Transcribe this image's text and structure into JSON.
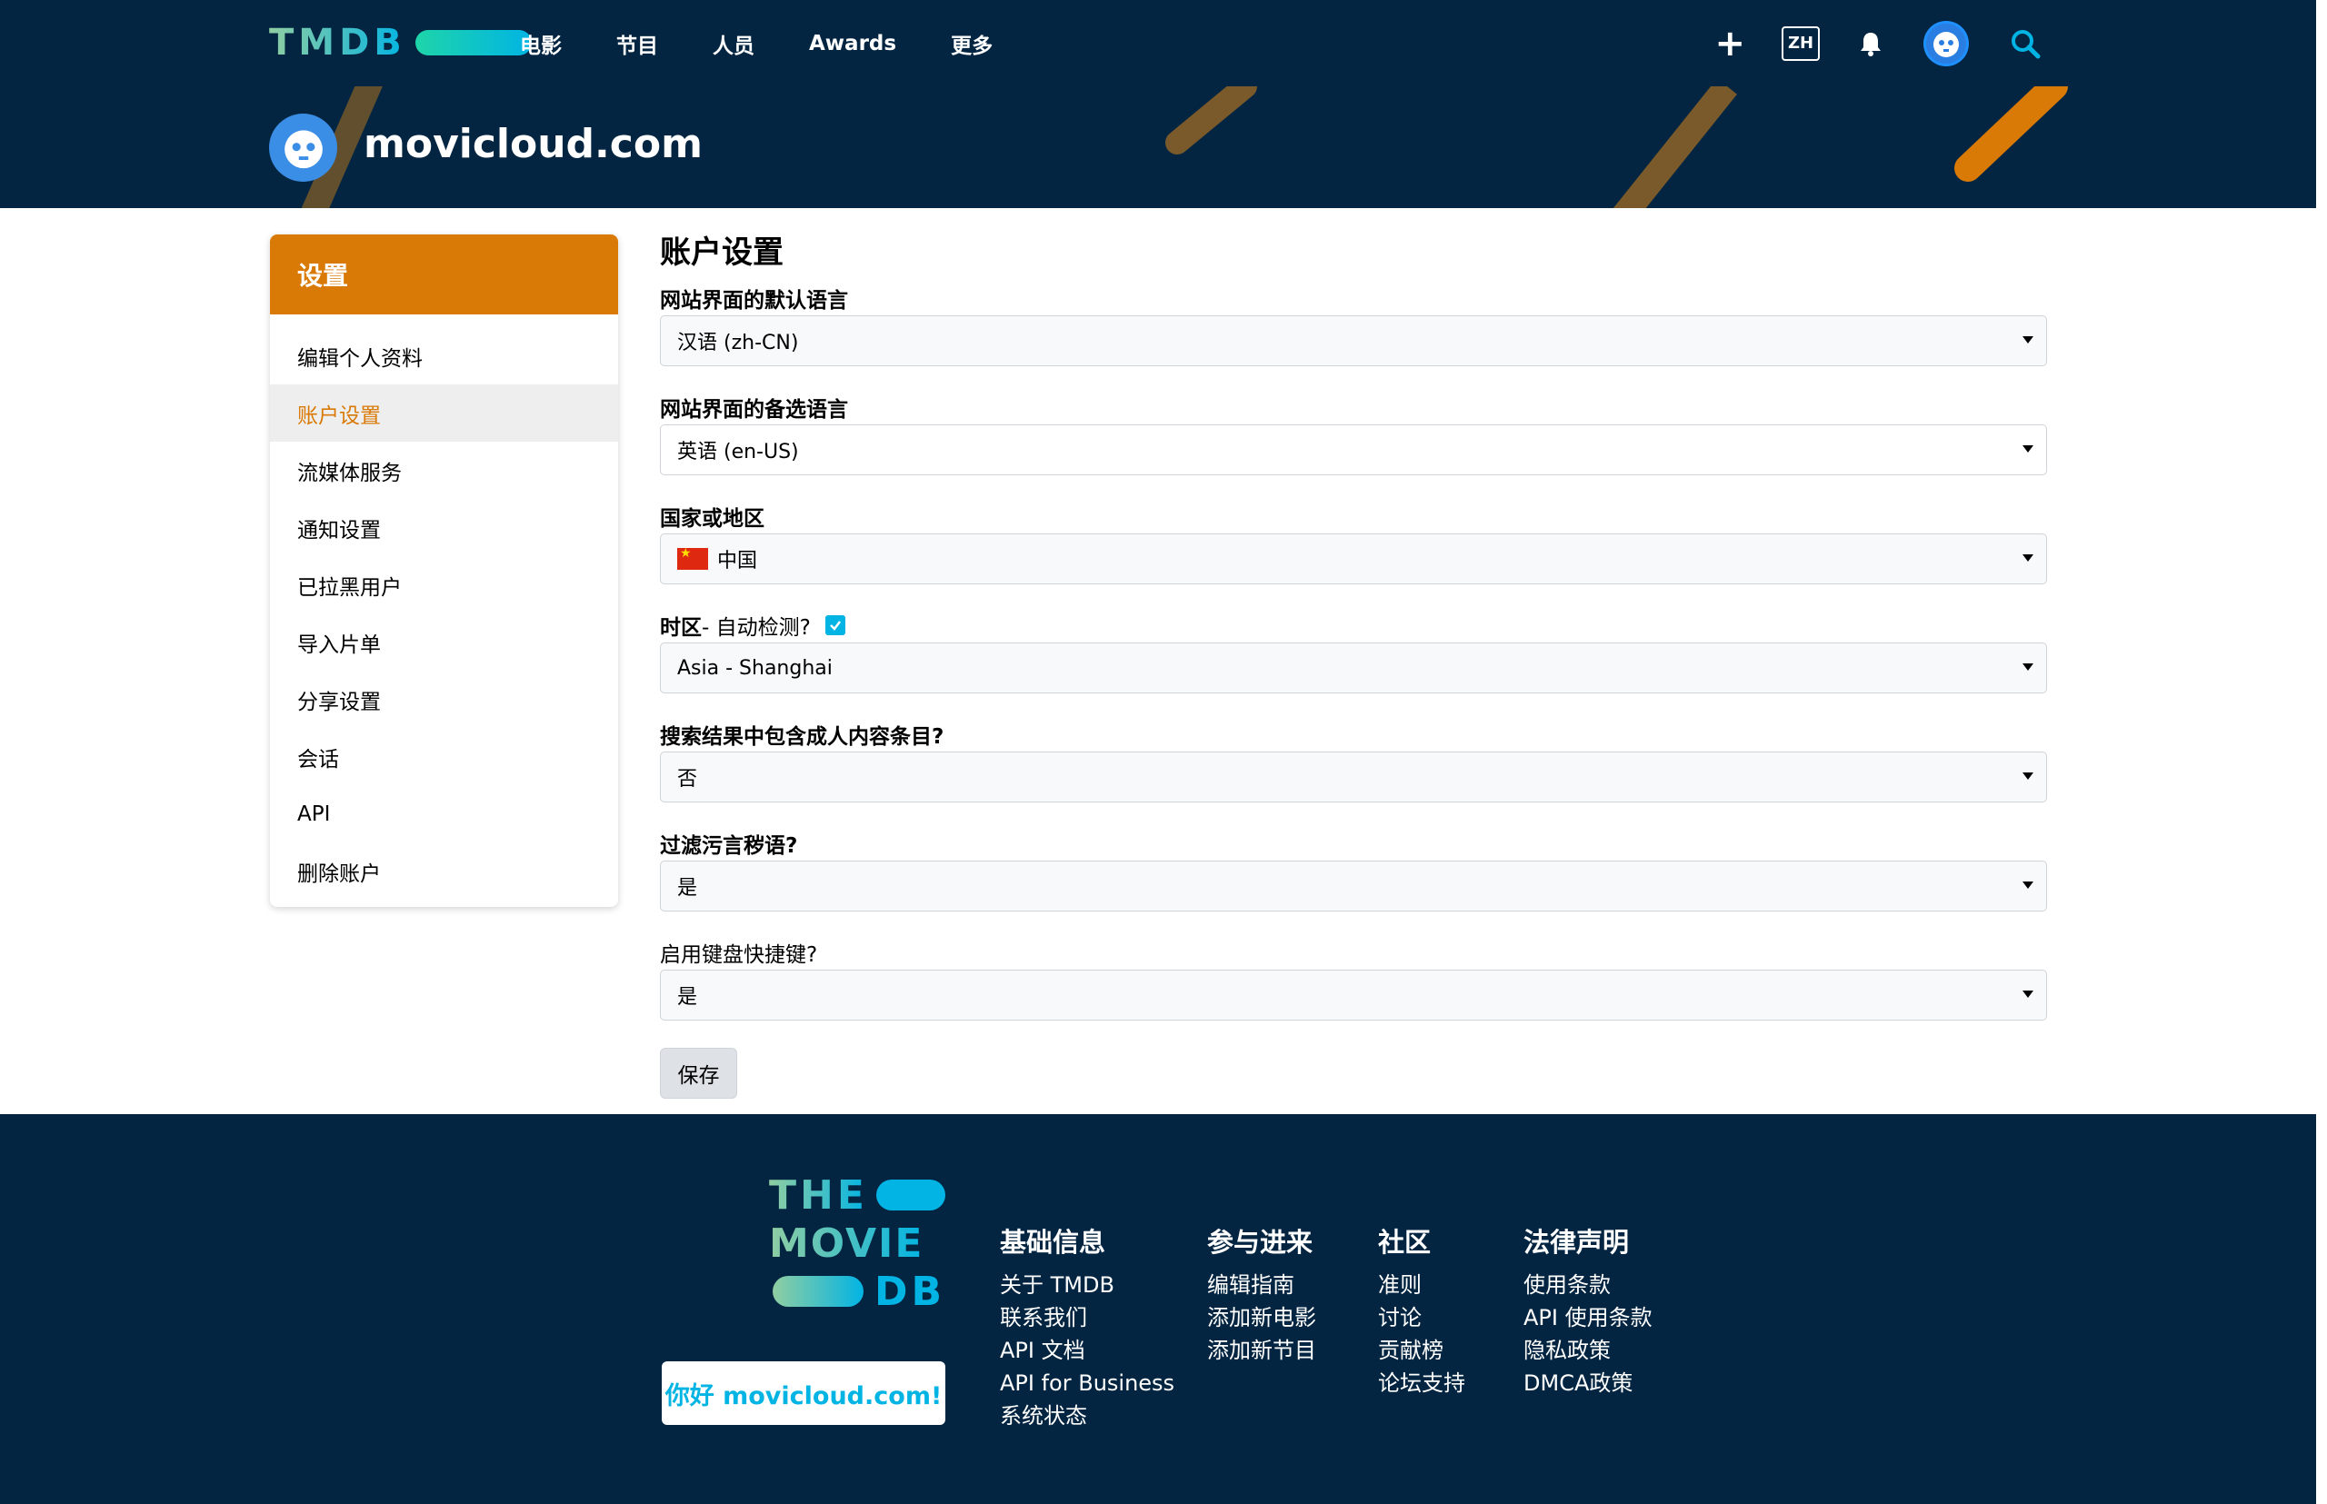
{
  "nav": {
    "logo": "TMDB",
    "links": [
      "电影",
      "节目",
      "人员",
      "Awards",
      "更多"
    ],
    "lang": "ZH",
    "plus": "+"
  },
  "profile": {
    "name": "movicloud.com"
  },
  "sidebar": {
    "header": "设置",
    "items": [
      {
        "label": "编辑个人资料"
      },
      {
        "label": "账户设置"
      },
      {
        "label": "流媒体服务"
      },
      {
        "label": "通知设置"
      },
      {
        "label": "已拉黑用户"
      },
      {
        "label": "导入片单"
      },
      {
        "label": "分享设置"
      },
      {
        "label": "会话"
      },
      {
        "label": "API"
      },
      {
        "label": "删除账户"
      }
    ],
    "active_index": 1
  },
  "form": {
    "title": "账户设置",
    "default_language": {
      "label": "网站界面的默认语言",
      "value": "汉语 (zh-CN)"
    },
    "fallback_language": {
      "label": "网站界面的备选语言",
      "value": "英语 (en-US)"
    },
    "country": {
      "label": "国家或地区",
      "value": "中国"
    },
    "timezone": {
      "label": "时区",
      "auto_label": " - 自动检测?",
      "auto_checked": true,
      "value": "Asia - Shanghai"
    },
    "adult": {
      "label": "搜索结果中包含成人内容条目?",
      "value": "否"
    },
    "profanity": {
      "label": "过滤污言秽语?",
      "value": "是"
    },
    "shortcuts": {
      "label": "启用键盘快捷键?",
      "value": "是"
    },
    "save_label": "保存"
  },
  "footer": {
    "logo_lines": [
      "THE",
      "MOVIE",
      "DB"
    ],
    "hello": "你好 movicloud.com!",
    "columns": [
      {
        "title": "基础信息",
        "links": [
          "关于 TMDB",
          "联系我们",
          "API 文档",
          "API for Business",
          "系统状态"
        ]
      },
      {
        "title": "参与进来",
        "links": [
          "编辑指南",
          "添加新电影",
          "添加新节目"
        ]
      },
      {
        "title": "社区",
        "links": [
          "准则",
          "讨论",
          "贡献榜",
          "论坛支持"
        ]
      },
      {
        "title": "法律声明",
        "links": [
          "使用条款",
          "API 使用条款",
          "隐私政策",
          "DMCA政策"
        ]
      }
    ]
  },
  "colors": {
    "navy": "#032541",
    "orange": "#d97a06",
    "accent": "#01b4e4"
  }
}
